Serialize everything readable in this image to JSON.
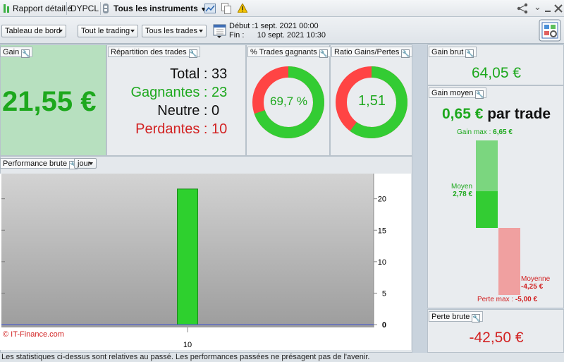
{
  "titlebar": {
    "report_label": "Rapport détaillé",
    "account": "DYPCL",
    "instruments_label": "Tous les instruments",
    "colors": {
      "green_flag": "#3cb043",
      "warning": "#f2c200"
    }
  },
  "toolbar": {
    "view_select": "Tableau de bord",
    "trading_select": "Tout le trading",
    "trades_select": "Tous les trades",
    "start_label": "Début :",
    "start_value": "1 sept. 2021 00:00",
    "end_label": "Fin :",
    "end_value": "10 sept. 2021 10:30"
  },
  "gain": {
    "title": "Gain",
    "value": "21,55 €",
    "color": "#1da81d",
    "bg": "#b7e0bf"
  },
  "repartition": {
    "title": "Répartition des trades",
    "rows": [
      {
        "label": "Total :",
        "value": "33",
        "color": "#111111"
      },
      {
        "label": "Gagnantes :",
        "value": "23",
        "color": "#1da81d"
      },
      {
        "label": "Neutre :",
        "value": "0",
        "color": "#111111"
      },
      {
        "label": "Perdantes :",
        "value": "10",
        "color": "#d22222"
      }
    ]
  },
  "pct_winners": {
    "title": "% Trades gagnants",
    "text": "69,7 %",
    "fraction": 0.697
  },
  "ratio": {
    "title": "Ratio Gains/Pertes",
    "text": "1,51",
    "fraction": 0.6016
  },
  "gain_brut": {
    "title": "Gain brut",
    "value": "64,05 €"
  },
  "gain_moyen": {
    "title": "Gain moyen",
    "value": "0,65 €",
    "suffix": "par trade",
    "gain_max_label": "Gain max :",
    "gain_max_value": "6,65 €",
    "moyen_label": "Moyen",
    "moyen_value": "2,78 €",
    "moyenne_label": "Moyenne",
    "moyenne_value": "-4,25 €",
    "perte_max_label": "Perte max :",
    "perte_max_value": "-5,00 €",
    "gain_max_num": 6.65,
    "moyen_num": 2.78,
    "moyenne_num": -4.25,
    "perte_max_num": -5.0
  },
  "perte_brute": {
    "title": "Perte brute",
    "value": "-42,50 €"
  },
  "performance": {
    "title": "Performance brute",
    "period_select": "jour",
    "watermark": "© IT-Finance.com"
  },
  "chart_data": {
    "type": "bar",
    "categories": [
      "10"
    ],
    "values": [
      21.55
    ],
    "ylim": [
      0,
      24
    ],
    "yticks": [
      "0",
      "5",
      "10",
      "15",
      "20"
    ],
    "ytick_values": [
      0,
      5,
      10,
      15,
      20
    ],
    "bar_color": "#2ed02e",
    "grid": false
  },
  "footer": "Les statistiques ci-dessus sont relatives au passé. Les performances passées ne présagent pas de l'avenir."
}
